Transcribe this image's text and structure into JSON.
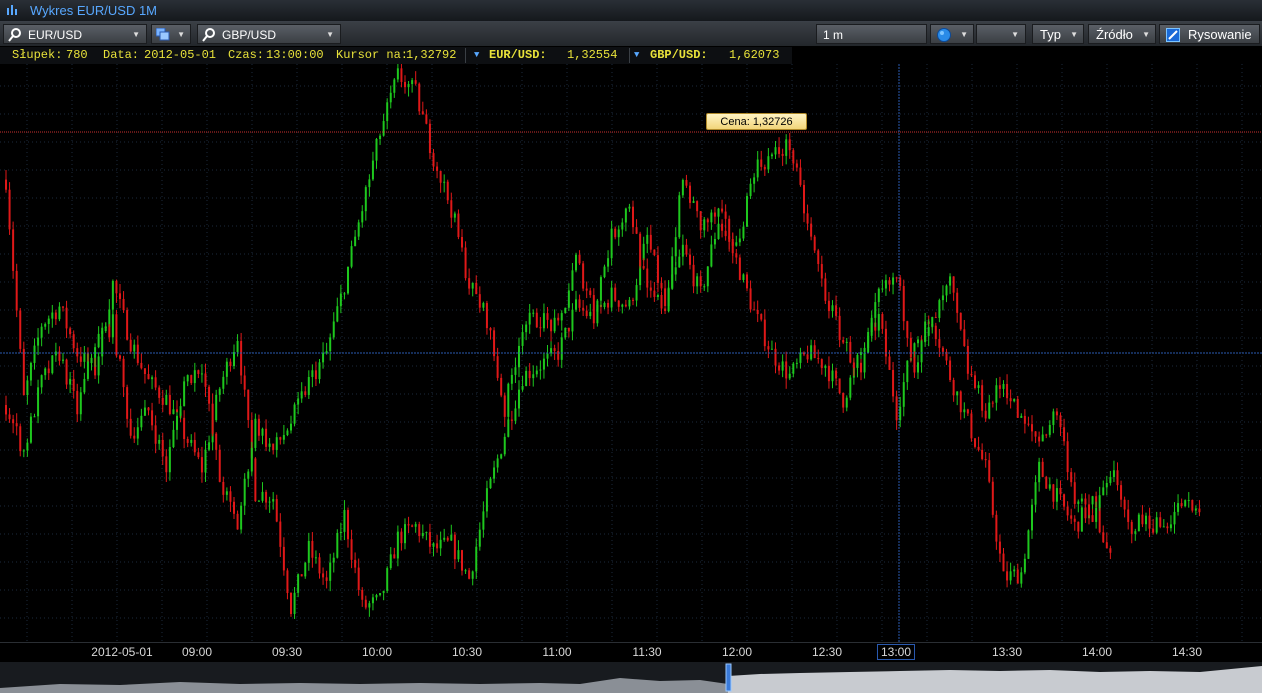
{
  "window": {
    "title": "Wykres EUR/USD 1M"
  },
  "toolbar": {
    "symbol1": "EUR/USD",
    "symbol2": "GBP/USD",
    "interval": "1 m",
    "type_label": "Typ",
    "source_label": "Źródło",
    "drawing_label": "Rysowanie"
  },
  "infobar": {
    "bar_label": "Słupek:",
    "bar_value": "780",
    "date_label": "Data:",
    "date_value": "2012-05-01",
    "time_label": "Czas:",
    "time_value": "13:00:00",
    "cursor_label": "Kursor na:",
    "cursor_value": "1,32792",
    "series1_name": "EUR/USD:",
    "series1_value": "1,32554",
    "series2_name": "GBP/USD:",
    "series2_value": "1,62073"
  },
  "price_tag": "Cena: 1,32726",
  "axis_labels": [
    "2012-05-01",
    "09:00",
    "09:30",
    "10:00",
    "10:30",
    "11:00",
    "11:30",
    "12:00",
    "12:30",
    "13:00",
    "13:30",
    "14:00",
    "14:30"
  ],
  "colors": {
    "up": "#1ec81e",
    "down": "#e01818",
    "grid": "#1b2a3c",
    "crosshair": "#2a5ab0",
    "hline": "#c83030",
    "title": "#58a8ff",
    "info": "#e8e23a"
  },
  "chart_data": {
    "type": "candlestick",
    "interval": "1 m",
    "series": [
      {
        "name": "EUR/USD",
        "path": [
          [
            0,
            0.8
          ],
          [
            5,
            0.42
          ],
          [
            10,
            0.55
          ],
          [
            15,
            0.58
          ],
          [
            20,
            0.5
          ],
          [
            25,
            0.47
          ],
          [
            30,
            0.62
          ],
          [
            35,
            0.52
          ],
          [
            40,
            0.45
          ],
          [
            45,
            0.42
          ],
          [
            50,
            0.36
          ],
          [
            55,
            0.3
          ],
          [
            60,
            0.44
          ],
          [
            65,
            0.53
          ],
          [
            70,
            0.26
          ],
          [
            75,
            0.25
          ],
          [
            80,
            0.06
          ],
          [
            85,
            0.16
          ],
          [
            90,
            0.1
          ],
          [
            95,
            0.22
          ],
          [
            100,
            0.06
          ],
          [
            105,
            0.07
          ],
          [
            110,
            0.18
          ],
          [
            115,
            0.2
          ],
          [
            120,
            0.16
          ],
          [
            125,
            0.17
          ],
          [
            130,
            0.11
          ],
          [
            135,
            0.25
          ],
          [
            140,
            0.36
          ],
          [
            145,
            0.46
          ],
          [
            150,
            0.48
          ],
          [
            155,
            0.5
          ],
          [
            160,
            0.58
          ],
          [
            165,
            0.56
          ],
          [
            170,
            0.6
          ],
          [
            175,
            0.58
          ],
          [
            180,
            0.7
          ],
          [
            185,
            0.58
          ],
          [
            190,
            0.68
          ],
          [
            195,
            0.6
          ],
          [
            200,
            0.73
          ],
          [
            205,
            0.66
          ],
          [
            210,
            0.57
          ],
          [
            215,
            0.5
          ],
          [
            220,
            0.46
          ],
          [
            225,
            0.5
          ],
          [
            230,
            0.48
          ],
          [
            235,
            0.42
          ],
          [
            240,
            0.5
          ],
          [
            245,
            0.56
          ],
          [
            250,
            0.4
          ],
          [
            255,
            0.52
          ],
          [
            260,
            0.56
          ],
          [
            265,
            0.46
          ],
          [
            270,
            0.38
          ],
          [
            275,
            0.3
          ],
          [
            280,
            0.11
          ],
          [
            285,
            0.12
          ],
          [
            290,
            0.3
          ],
          [
            295,
            0.25
          ],
          [
            300,
            0.2
          ],
          [
            305,
            0.24
          ],
          [
            310,
            0.14
          ]
        ]
      },
      {
        "name": "GBP/USD",
        "path": [
          [
            0,
            0.41
          ],
          [
            5,
            0.33
          ],
          [
            10,
            0.45
          ],
          [
            15,
            0.5
          ],
          [
            20,
            0.4
          ],
          [
            25,
            0.52
          ],
          [
            30,
            0.55
          ],
          [
            35,
            0.36
          ],
          [
            40,
            0.4
          ],
          [
            45,
            0.3
          ],
          [
            50,
            0.45
          ],
          [
            55,
            0.48
          ],
          [
            60,
            0.28
          ],
          [
            65,
            0.2
          ],
          [
            70,
            0.38
          ],
          [
            75,
            0.33
          ],
          [
            80,
            0.38
          ],
          [
            85,
            0.45
          ],
          [
            90,
            0.5
          ],
          [
            95,
            0.62
          ],
          [
            100,
            0.75
          ],
          [
            105,
            0.88
          ],
          [
            110,
            0.98
          ],
          [
            115,
            0.95
          ],
          [
            120,
            0.84
          ],
          [
            125,
            0.75
          ],
          [
            130,
            0.62
          ],
          [
            135,
            0.56
          ],
          [
            140,
            0.4
          ],
          [
            145,
            0.55
          ],
          [
            150,
            0.56
          ],
          [
            155,
            0.54
          ],
          [
            160,
            0.66
          ],
          [
            165,
            0.58
          ],
          [
            170,
            0.7
          ],
          [
            175,
            0.76
          ],
          [
            180,
            0.6
          ],
          [
            185,
            0.58
          ],
          [
            190,
            0.8
          ],
          [
            195,
            0.72
          ],
          [
            200,
            0.74
          ],
          [
            205,
            0.68
          ],
          [
            210,
            0.82
          ],
          [
            215,
            0.84
          ],
          [
            220,
            0.86
          ],
          [
            225,
            0.72
          ],
          [
            230,
            0.6
          ],
          [
            235,
            0.52
          ],
          [
            240,
            0.46
          ],
          [
            245,
            0.6
          ],
          [
            250,
            0.63
          ],
          [
            255,
            0.48
          ],
          [
            260,
            0.55
          ],
          [
            265,
            0.62
          ],
          [
            270,
            0.47
          ],
          [
            275,
            0.4
          ],
          [
            280,
            0.45
          ],
          [
            285,
            0.38
          ],
          [
            290,
            0.35
          ],
          [
            295,
            0.4
          ],
          [
            300,
            0.25
          ],
          [
            305,
            0.21
          ],
          [
            310,
            0.3
          ],
          [
            315,
            0.2
          ],
          [
            320,
            0.21
          ],
          [
            325,
            0.2
          ],
          [
            330,
            0.24
          ],
          [
            335,
            0.22
          ]
        ]
      }
    ]
  }
}
